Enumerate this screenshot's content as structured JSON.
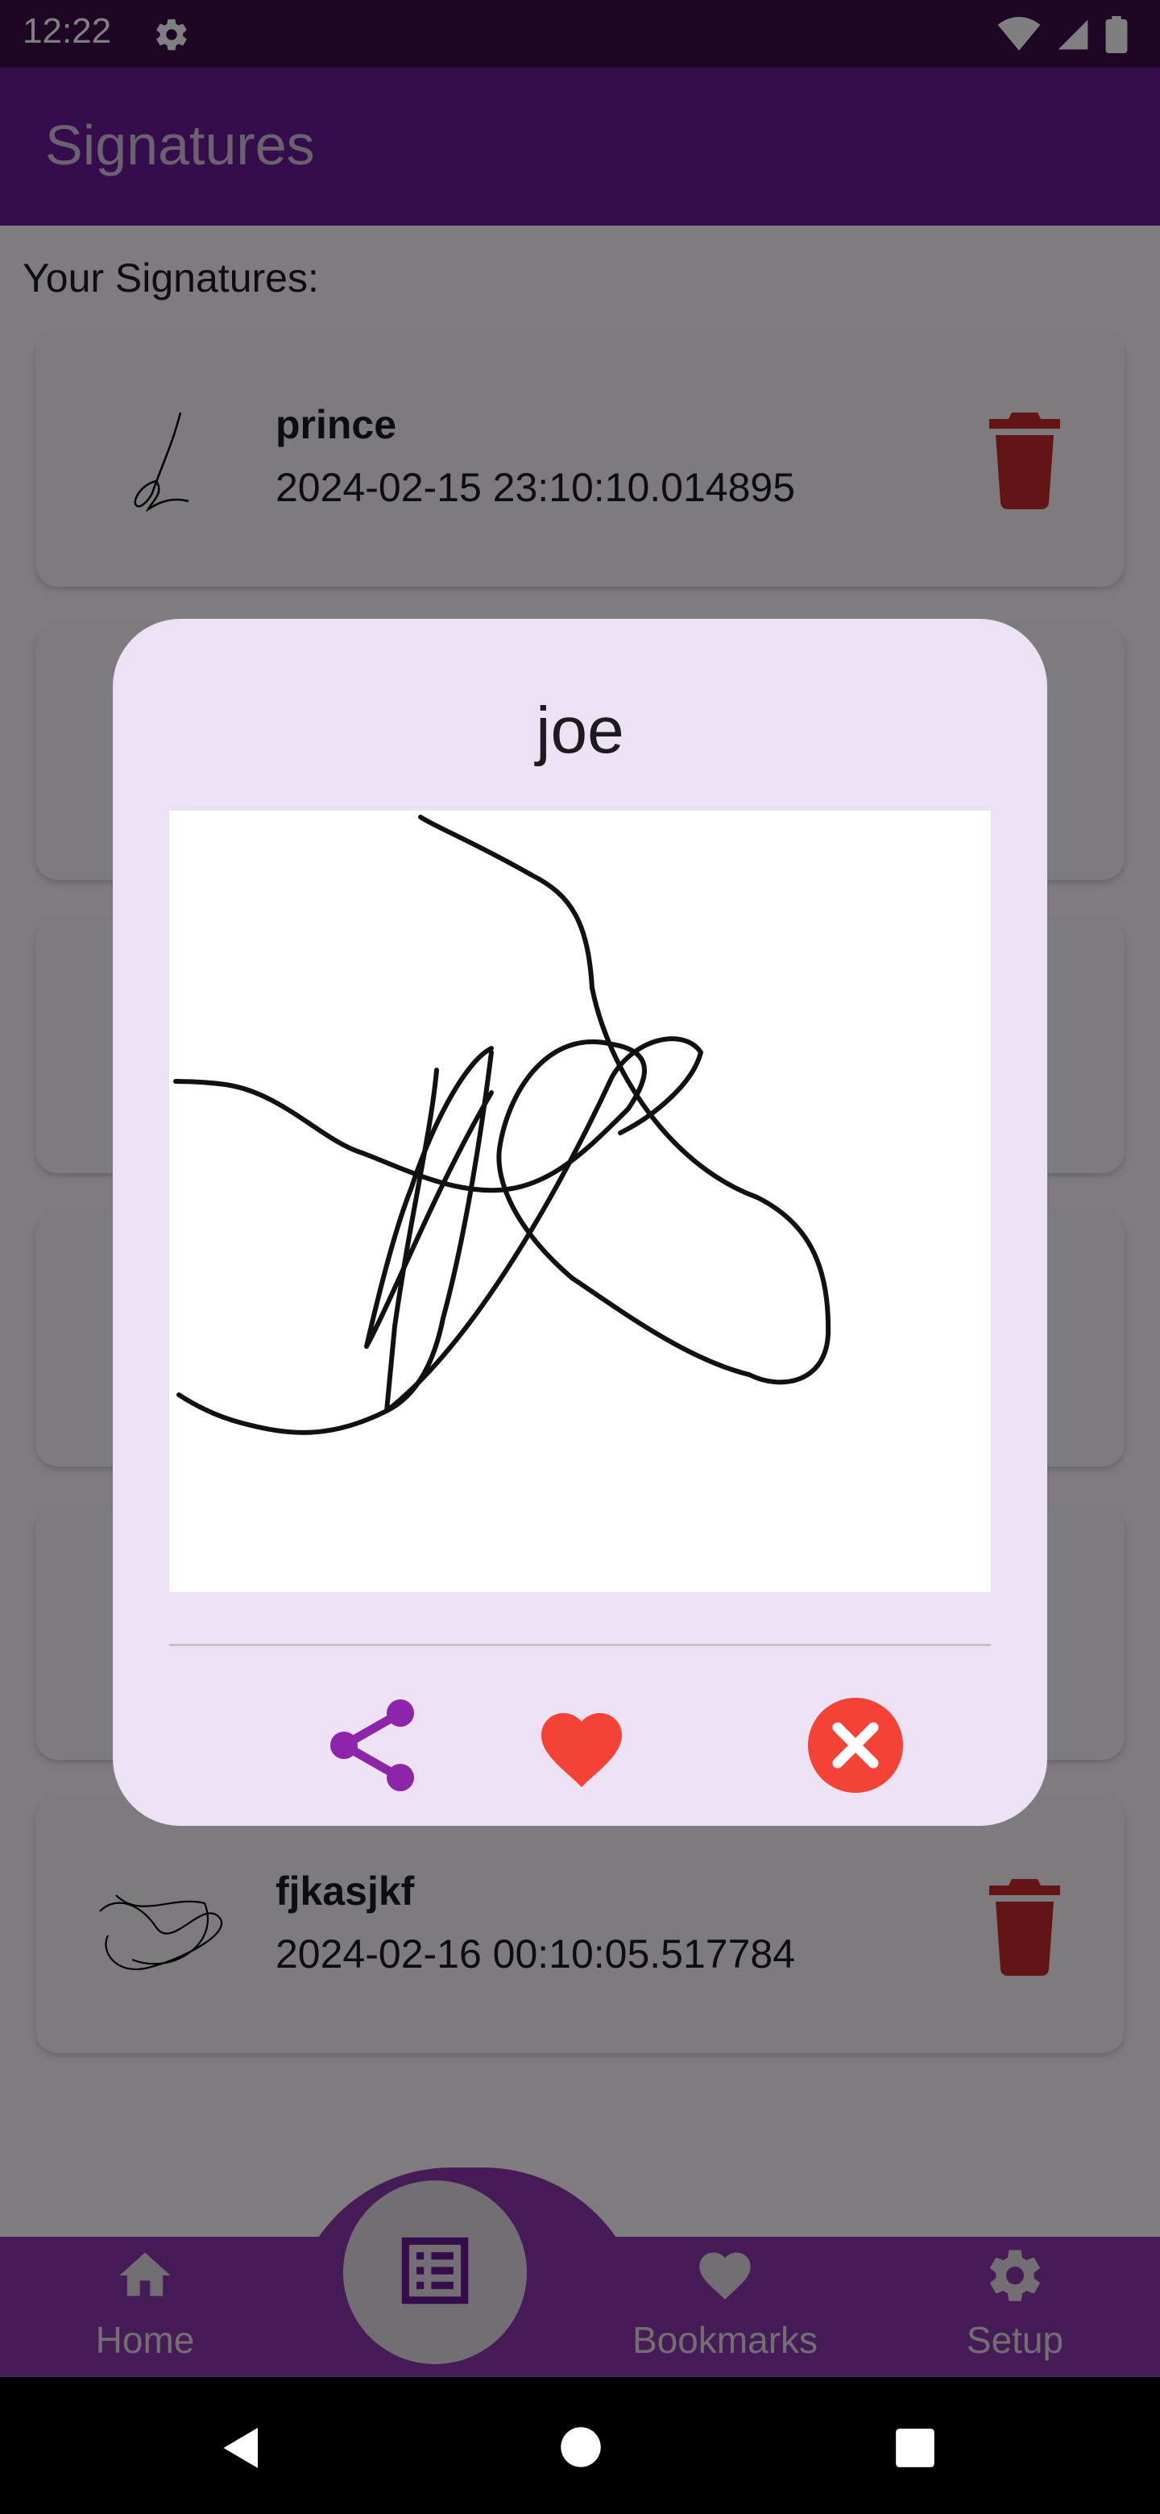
{
  "status_bar": {
    "time": "12:22"
  },
  "app_bar": {
    "title": "Signatures"
  },
  "main": {
    "section_label": "Your Signatures:",
    "cards": [
      {
        "name": "prince",
        "date": "2024-02-15 23:10:10.014895"
      },
      {
        "name": "fjkasjkf",
        "date": "2024-02-16 00:10:05.517784"
      }
    ]
  },
  "bottom_nav": {
    "items": [
      {
        "label": "Home",
        "icon": "home-icon"
      },
      {
        "label": "",
        "icon": "list-icon"
      },
      {
        "label": "Bookmarks",
        "icon": "heart-icon"
      },
      {
        "label": "Setup",
        "icon": "gear-icon"
      }
    ]
  },
  "dialog": {
    "title": "joe",
    "actions": [
      {
        "icon": "share-icon",
        "color": "#8e24aa"
      },
      {
        "icon": "heart-icon",
        "color": "#f44336"
      },
      {
        "icon": "close-circle-icon",
        "color": "#f44336"
      }
    ]
  },
  "colors": {
    "status_bar": "#3a0e48",
    "app_bar": "#6a1b9a",
    "bottom_nav": "#8d39ad",
    "dialog_bg": "#ece2f4",
    "trash": "#c62828"
  }
}
